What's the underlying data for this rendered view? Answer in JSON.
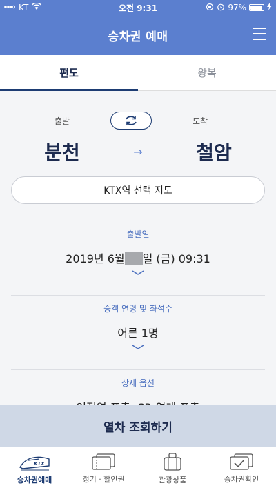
{
  "status": {
    "carrier": "KT",
    "time": "오전 9:31",
    "battery": "97%",
    "battery_level": 0.97
  },
  "header": {
    "title": "승차권 예매"
  },
  "tabs": [
    {
      "label": "편도"
    },
    {
      "label": "왕복"
    }
  ],
  "route": {
    "depart_label": "출발",
    "arrive_label": "도착",
    "depart_station": "분천",
    "arrive_station": "철암",
    "arrow": "→"
  },
  "map_button": "KTX역 선택 지도",
  "departure_date": {
    "title": "출발일",
    "value_before": "2019년 6월",
    "value_after": "일 (금) 09:31"
  },
  "passengers": {
    "title": "승객 연령 및 좌석수",
    "value": "어른 1명"
  },
  "options": {
    "title": "상세 옵션",
    "value": "인접역 표출, SR 연계 표출"
  },
  "cta": "열차 조회하기",
  "bottom_nav": [
    {
      "label": "승차권예매",
      "icon": "ktx-train-icon"
    },
    {
      "label": "정기 · 할인권",
      "icon": "tickets-icon"
    },
    {
      "label": "관광상품",
      "icon": "luggage-icon"
    },
    {
      "label": "승차권확인",
      "icon": "ticket-check-icon"
    }
  ]
}
